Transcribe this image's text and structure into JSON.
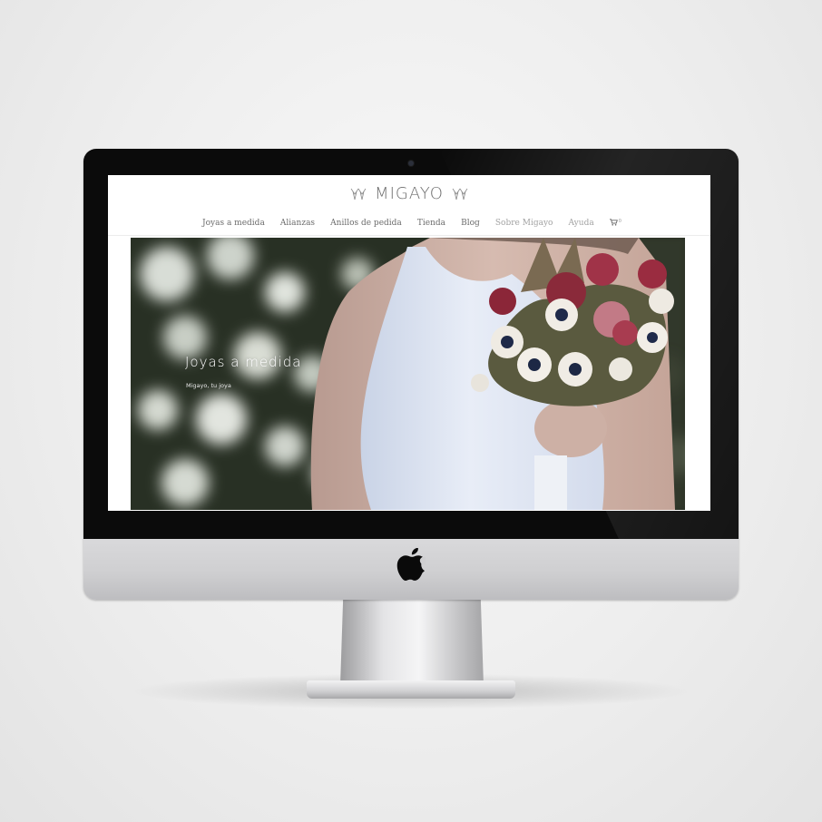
{
  "site": {
    "logo_text": "MIGAYO",
    "nav": [
      {
        "label": "Joyas a medida"
      },
      {
        "label": "Alianzas"
      },
      {
        "label": "Anillos de pedida"
      },
      {
        "label": "Tienda"
      },
      {
        "label": "Blog"
      },
      {
        "label": "Sobre Migayo"
      },
      {
        "label": "Ayuda"
      }
    ],
    "cart_count": "0"
  },
  "hero": {
    "title": "Joyas a medida",
    "subtitle": "Migayo, tu joya"
  },
  "colors": {
    "nav_text": "#6b6b6b",
    "logo": "#6e6e6e",
    "bezel": "#0b0b0b",
    "chin": "#cfcfd1",
    "dress": "#dfe6f3"
  },
  "icons": [
    "logo-diamond-icon",
    "cart-icon",
    "apple-logo-icon"
  ]
}
